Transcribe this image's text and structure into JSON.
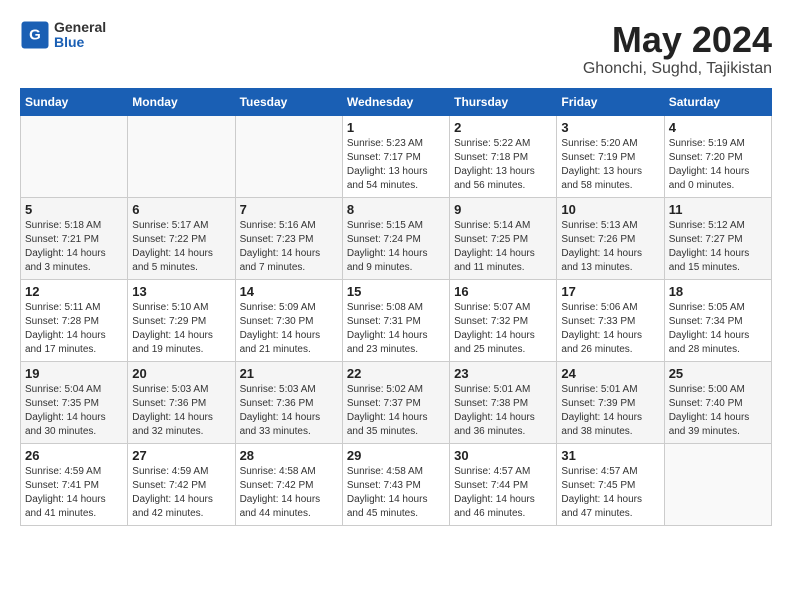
{
  "header": {
    "logo_general": "General",
    "logo_blue": "Blue",
    "month_year": "May 2024",
    "location": "Ghonchi, Sughd, Tajikistan"
  },
  "weekdays": [
    "Sunday",
    "Monday",
    "Tuesday",
    "Wednesday",
    "Thursday",
    "Friday",
    "Saturday"
  ],
  "weeks": [
    [
      {
        "day": "",
        "info": ""
      },
      {
        "day": "",
        "info": ""
      },
      {
        "day": "",
        "info": ""
      },
      {
        "day": "1",
        "info": "Sunrise: 5:23 AM\nSunset: 7:17 PM\nDaylight: 13 hours\nand 54 minutes."
      },
      {
        "day": "2",
        "info": "Sunrise: 5:22 AM\nSunset: 7:18 PM\nDaylight: 13 hours\nand 56 minutes."
      },
      {
        "day": "3",
        "info": "Sunrise: 5:20 AM\nSunset: 7:19 PM\nDaylight: 13 hours\nand 58 minutes."
      },
      {
        "day": "4",
        "info": "Sunrise: 5:19 AM\nSunset: 7:20 PM\nDaylight: 14 hours\nand 0 minutes."
      }
    ],
    [
      {
        "day": "5",
        "info": "Sunrise: 5:18 AM\nSunset: 7:21 PM\nDaylight: 14 hours\nand 3 minutes."
      },
      {
        "day": "6",
        "info": "Sunrise: 5:17 AM\nSunset: 7:22 PM\nDaylight: 14 hours\nand 5 minutes."
      },
      {
        "day": "7",
        "info": "Sunrise: 5:16 AM\nSunset: 7:23 PM\nDaylight: 14 hours\nand 7 minutes."
      },
      {
        "day": "8",
        "info": "Sunrise: 5:15 AM\nSunset: 7:24 PM\nDaylight: 14 hours\nand 9 minutes."
      },
      {
        "day": "9",
        "info": "Sunrise: 5:14 AM\nSunset: 7:25 PM\nDaylight: 14 hours\nand 11 minutes."
      },
      {
        "day": "10",
        "info": "Sunrise: 5:13 AM\nSunset: 7:26 PM\nDaylight: 14 hours\nand 13 minutes."
      },
      {
        "day": "11",
        "info": "Sunrise: 5:12 AM\nSunset: 7:27 PM\nDaylight: 14 hours\nand 15 minutes."
      }
    ],
    [
      {
        "day": "12",
        "info": "Sunrise: 5:11 AM\nSunset: 7:28 PM\nDaylight: 14 hours\nand 17 minutes."
      },
      {
        "day": "13",
        "info": "Sunrise: 5:10 AM\nSunset: 7:29 PM\nDaylight: 14 hours\nand 19 minutes."
      },
      {
        "day": "14",
        "info": "Sunrise: 5:09 AM\nSunset: 7:30 PM\nDaylight: 14 hours\nand 21 minutes."
      },
      {
        "day": "15",
        "info": "Sunrise: 5:08 AM\nSunset: 7:31 PM\nDaylight: 14 hours\nand 23 minutes."
      },
      {
        "day": "16",
        "info": "Sunrise: 5:07 AM\nSunset: 7:32 PM\nDaylight: 14 hours\nand 25 minutes."
      },
      {
        "day": "17",
        "info": "Sunrise: 5:06 AM\nSunset: 7:33 PM\nDaylight: 14 hours\nand 26 minutes."
      },
      {
        "day": "18",
        "info": "Sunrise: 5:05 AM\nSunset: 7:34 PM\nDaylight: 14 hours\nand 28 minutes."
      }
    ],
    [
      {
        "day": "19",
        "info": "Sunrise: 5:04 AM\nSunset: 7:35 PM\nDaylight: 14 hours\nand 30 minutes."
      },
      {
        "day": "20",
        "info": "Sunrise: 5:03 AM\nSunset: 7:36 PM\nDaylight: 14 hours\nand 32 minutes."
      },
      {
        "day": "21",
        "info": "Sunrise: 5:03 AM\nSunset: 7:36 PM\nDaylight: 14 hours\nand 33 minutes."
      },
      {
        "day": "22",
        "info": "Sunrise: 5:02 AM\nSunset: 7:37 PM\nDaylight: 14 hours\nand 35 minutes."
      },
      {
        "day": "23",
        "info": "Sunrise: 5:01 AM\nSunset: 7:38 PM\nDaylight: 14 hours\nand 36 minutes."
      },
      {
        "day": "24",
        "info": "Sunrise: 5:01 AM\nSunset: 7:39 PM\nDaylight: 14 hours\nand 38 minutes."
      },
      {
        "day": "25",
        "info": "Sunrise: 5:00 AM\nSunset: 7:40 PM\nDaylight: 14 hours\nand 39 minutes."
      }
    ],
    [
      {
        "day": "26",
        "info": "Sunrise: 4:59 AM\nSunset: 7:41 PM\nDaylight: 14 hours\nand 41 minutes."
      },
      {
        "day": "27",
        "info": "Sunrise: 4:59 AM\nSunset: 7:42 PM\nDaylight: 14 hours\nand 42 minutes."
      },
      {
        "day": "28",
        "info": "Sunrise: 4:58 AM\nSunset: 7:42 PM\nDaylight: 14 hours\nand 44 minutes."
      },
      {
        "day": "29",
        "info": "Sunrise: 4:58 AM\nSunset: 7:43 PM\nDaylight: 14 hours\nand 45 minutes."
      },
      {
        "day": "30",
        "info": "Sunrise: 4:57 AM\nSunset: 7:44 PM\nDaylight: 14 hours\nand 46 minutes."
      },
      {
        "day": "31",
        "info": "Sunrise: 4:57 AM\nSunset: 7:45 PM\nDaylight: 14 hours\nand 47 minutes."
      },
      {
        "day": "",
        "info": ""
      }
    ]
  ]
}
